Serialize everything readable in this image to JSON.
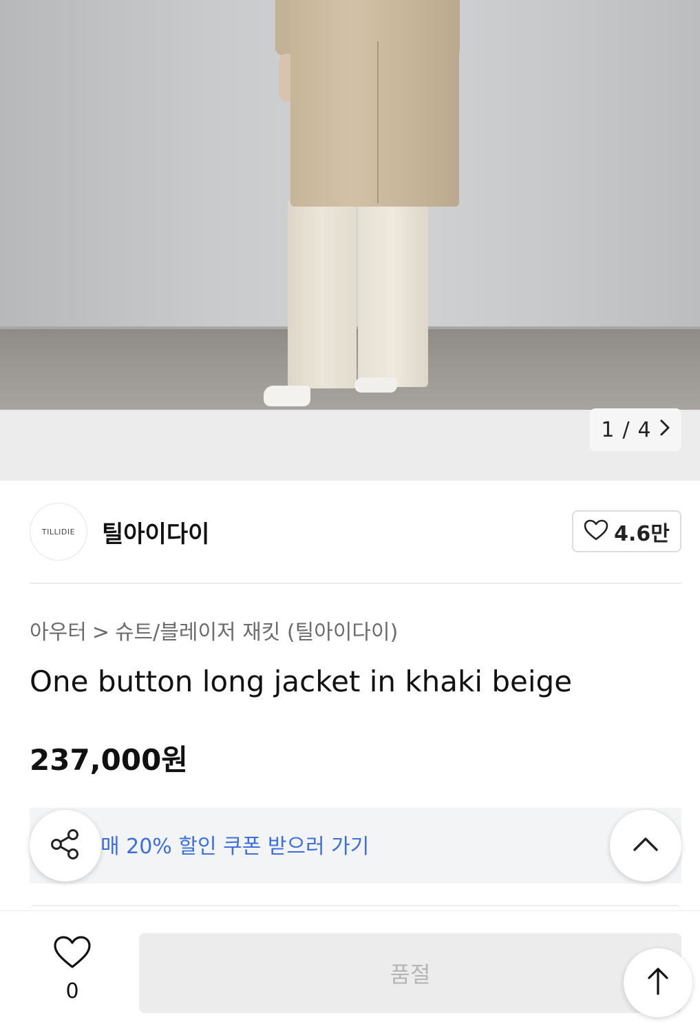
{
  "gallery": {
    "pager_current": "1",
    "pager_separator": "/",
    "pager_total": "4",
    "next_icon": "chevron-right-icon"
  },
  "seller": {
    "logo_text": "TILLIDIE",
    "name": "틸아이다이",
    "favorite_count": "4.6만",
    "favorite_icon": "heart-outline-icon"
  },
  "product": {
    "breadcrumb": [
      "아우터",
      "슈트/블레이저 재킷 (틸아이다이)"
    ],
    "breadcrumb_separator": ">",
    "title": "One button long jacket in khaki beige",
    "price": "237,000원"
  },
  "coupon": {
    "text": "매 20% 할인 쿠폰 받으러 가기",
    "accent_color": "#3b6ee0"
  },
  "floating": {
    "share_icon": "share-icon",
    "collapse_icon": "chevron-up-icon",
    "top_icon": "arrow-up-icon"
  },
  "bottom_bar": {
    "like_icon": "heart-outline-icon",
    "like_count": "0",
    "purchase_label": "품절"
  }
}
